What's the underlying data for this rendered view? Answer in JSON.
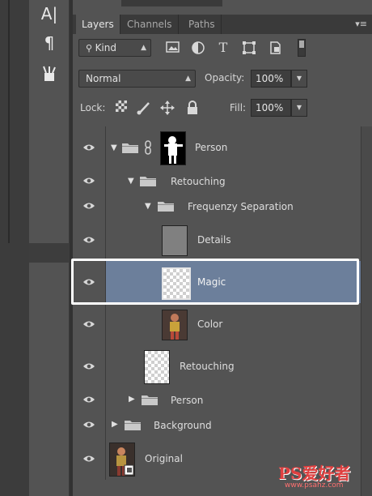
{
  "tools": {
    "icons": [
      "character-panel-icon",
      "paragraph-icon",
      "tool-presets-icon"
    ],
    "glyphs": [
      "A|",
      "¶",
      "✎"
    ]
  },
  "panel": {
    "tabs": [
      {
        "label": "Layers",
        "active": true
      },
      {
        "label": "Channels",
        "active": false
      },
      {
        "label": "Paths",
        "active": false
      }
    ],
    "menu_glyph": "▾≡"
  },
  "filter": {
    "kind_label": "Kind",
    "icons": [
      "pixel-filter-icon",
      "adjustment-filter-icon",
      "type-filter-icon",
      "shape-filter-icon",
      "smart-object-filter-icon"
    ]
  },
  "blend": {
    "mode": "Normal",
    "opacity_label": "Opacity:",
    "opacity_value": "100%"
  },
  "lock": {
    "label": "Lock:",
    "fill_label": "Fill:",
    "fill_value": "100%"
  },
  "layers": [
    {
      "name": "Person",
      "kind": "group-with-mask",
      "expanded": true,
      "selected": false
    },
    {
      "name": "Retouching",
      "kind": "group",
      "expanded": true,
      "selected": false
    },
    {
      "name": "Frequenzy Separation",
      "kind": "group",
      "expanded": true,
      "selected": false
    },
    {
      "name": "Details",
      "kind": "layer",
      "thumb": "gray",
      "selected": false
    },
    {
      "name": "Magic",
      "kind": "layer",
      "thumb": "transparent",
      "selected": true
    },
    {
      "name": "Color",
      "kind": "layer",
      "thumb": "photo",
      "selected": false
    },
    {
      "name": "Retouching",
      "kind": "layer",
      "thumb": "transparent",
      "selected": false
    },
    {
      "name": "Person",
      "kind": "group",
      "expanded": false,
      "selected": false
    },
    {
      "name": "Background",
      "kind": "group",
      "expanded": false,
      "selected": false
    },
    {
      "name": "Original",
      "kind": "layer",
      "thumb": "photo-smart",
      "selected": false
    }
  ],
  "colors": {
    "panel_bg": "#535353",
    "selection": "#6c7f9b",
    "highlight_outline": "#ffffff"
  },
  "watermark": {
    "main": "PS爱好者",
    "sub": "www.psahz.com"
  }
}
